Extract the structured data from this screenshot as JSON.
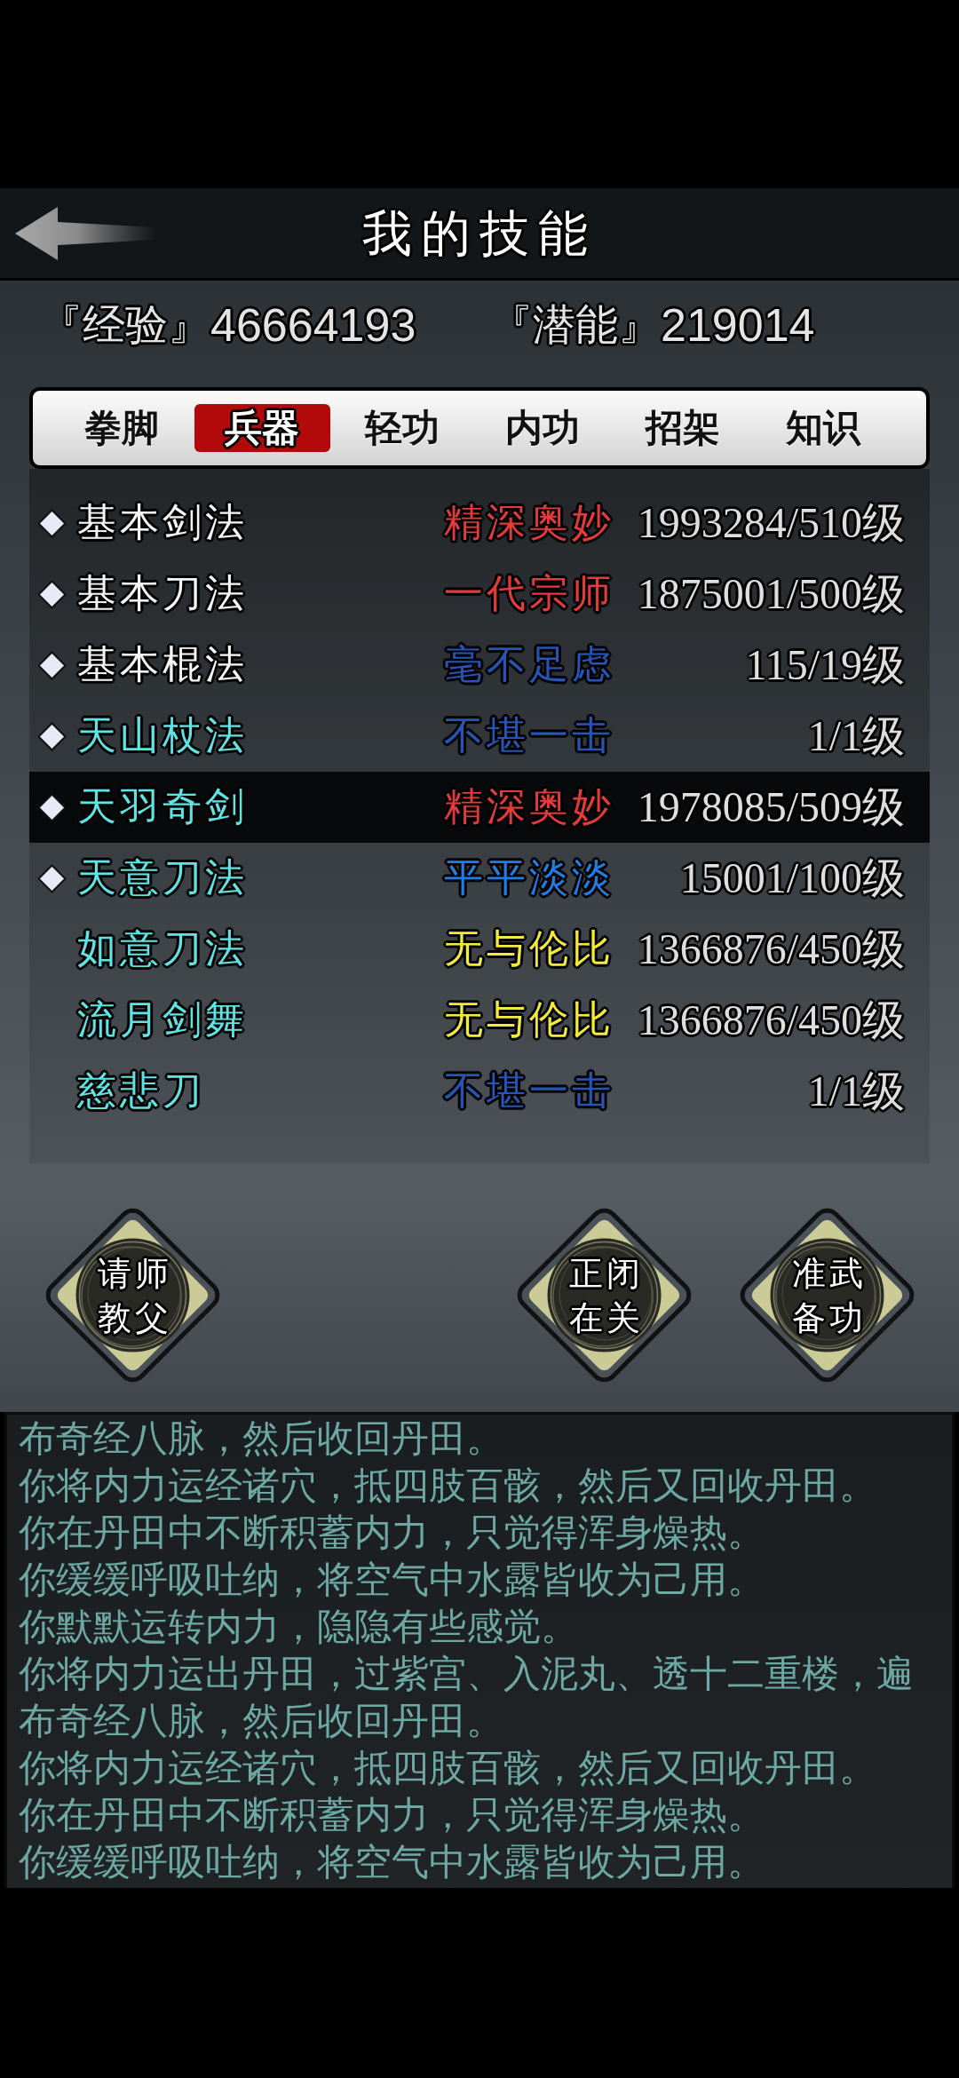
{
  "header": {
    "title": "我的技能"
  },
  "stats": [
    {
      "label": "『经验』",
      "value": "46664193"
    },
    {
      "label": "『潜能』",
      "value": "219014"
    }
  ],
  "tabs": [
    {
      "label": "拳脚",
      "selected": false
    },
    {
      "label": "兵器",
      "selected": true
    },
    {
      "label": "轻功",
      "selected": false
    },
    {
      "label": "内功",
      "selected": false
    },
    {
      "label": "招架",
      "selected": false
    },
    {
      "label": "知识",
      "selected": false
    }
  ],
  "skills": [
    {
      "marked": true,
      "name": {
        "text": "基本剑法",
        "color": "#f5f5f5"
      },
      "rank": {
        "text": "精深奥妙",
        "color": "#e33b3b"
      },
      "progress": "1993284/510级",
      "selected": false
    },
    {
      "marked": true,
      "name": {
        "text": "基本刀法",
        "color": "#f5f5f5"
      },
      "rank": {
        "text": "一代宗师",
        "color": "#e33b3b"
      },
      "progress": "1875001/500级",
      "selected": false
    },
    {
      "marked": true,
      "name": {
        "text": "基本棍法",
        "color": "#f5f5f5"
      },
      "rank": {
        "text": "毫不足虑",
        "color": "#2656b5"
      },
      "progress": "115/19级",
      "selected": false
    },
    {
      "marked": true,
      "name": {
        "text": "天山杖法",
        "color": "#5fe3e3"
      },
      "rank": {
        "text": "不堪一击",
        "color": "#2656b5"
      },
      "progress": "1/1级",
      "selected": false
    },
    {
      "marked": true,
      "name": {
        "text": "天羽奇剑",
        "color": "#5fe3e3"
      },
      "rank": {
        "text": "精深奥妙",
        "color": "#e33b3b"
      },
      "progress": "1978085/509级",
      "selected": true
    },
    {
      "marked": true,
      "name": {
        "text": "天意刀法",
        "color": "#5fe3e3"
      },
      "rank": {
        "text": "平平淡淡",
        "color": "#1f7fe6"
      },
      "progress": "15001/100级",
      "selected": false
    },
    {
      "marked": false,
      "name": {
        "text": "如意刀法",
        "color": "#5fe3e3"
      },
      "rank": {
        "text": "无与伦比",
        "color": "#f3ea3c"
      },
      "progress": "1366876/450级",
      "selected": false
    },
    {
      "marked": false,
      "name": {
        "text": "流月剑舞",
        "color": "#5fe3e3"
      },
      "rank": {
        "text": "无与伦比",
        "color": "#f3ea3c"
      },
      "progress": "1366876/450级",
      "selected": false
    },
    {
      "marked": false,
      "name": {
        "text": "慈悲刀",
        "color": "#5fe3e3"
      },
      "rank": {
        "text": "不堪一击",
        "color": "#2656b5"
      },
      "progress": "1/1级",
      "selected": false
    }
  ],
  "actions": [
    {
      "label": "请教师父"
    },
    {
      "label": "正在闭关"
    },
    {
      "label": "准备武功"
    }
  ],
  "log": [
    "布奇经八脉，然后收回丹田。",
    "你将内力运经诸穴，抵四肢百骸，然后又回收丹田。",
    "你在丹田中不断积蓄内力，只觉得浑身燥热。",
    "你缓缓呼吸吐纳，将空气中水露皆收为己用。",
    "你默默运转内力，隐隐有些感觉。",
    "你将内力运出丹田，过紫宫、入泥丸、透十二重楼，遍布奇经八脉，然后收回丹田。",
    "你将内力运经诸穴，抵四肢百骸，然后又回收丹田。",
    "你在丹田中不断积蓄内力，只觉得浑身燥热。",
    "你缓缓呼吸吐纳，将空气中水露皆收为己用。"
  ]
}
